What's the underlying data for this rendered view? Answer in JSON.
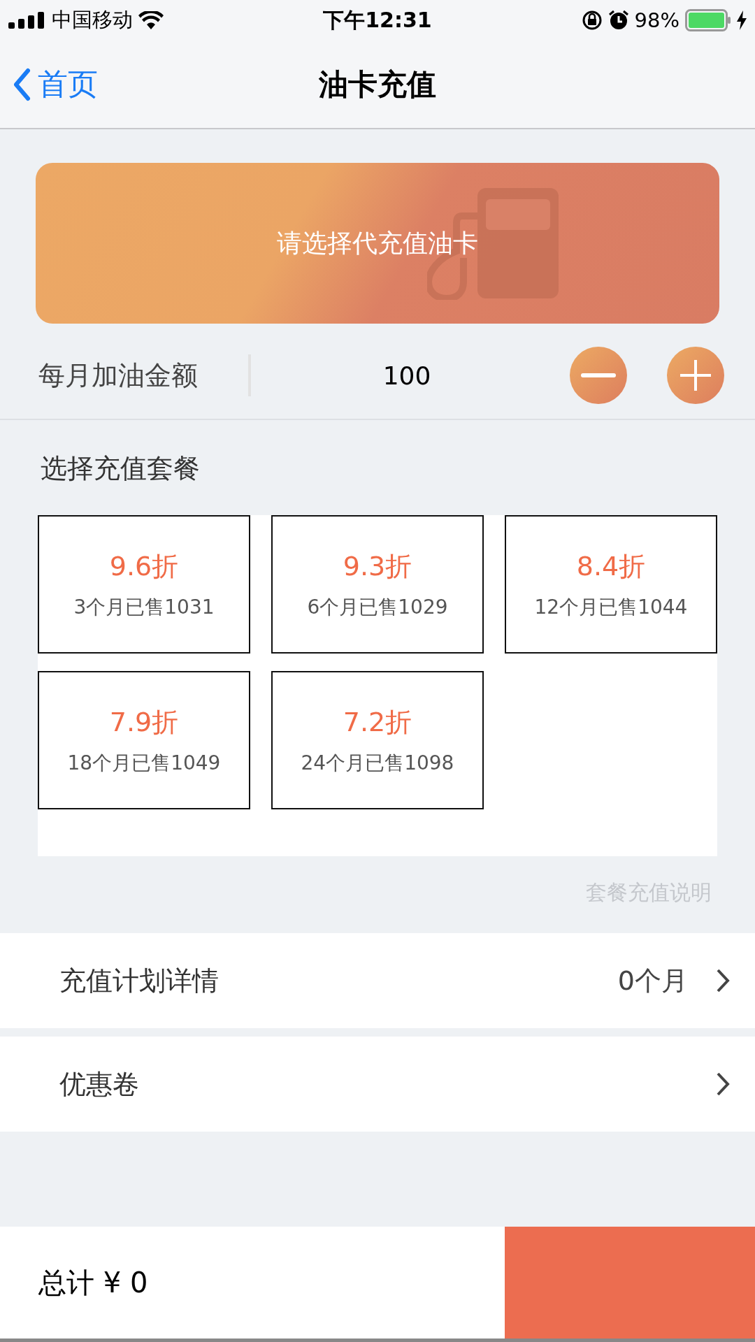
{
  "status_bar": {
    "carrier": "中国移动",
    "time": "下午12:31",
    "battery": "98%"
  },
  "nav": {
    "back": "首页",
    "title": "油卡充值"
  },
  "card_banner": {
    "label": "请选择代充值油卡"
  },
  "monthly_amount": {
    "label": "每月加油金额",
    "value": "100"
  },
  "packages": {
    "title": "选择充值套餐",
    "items": [
      {
        "discount": "9.6折",
        "detail": "3个月已售1031"
      },
      {
        "discount": "9.3折",
        "detail": "6个月已售1029"
      },
      {
        "discount": "8.4折",
        "detail": "12个月已售1044"
      },
      {
        "discount": "7.9折",
        "detail": "18个月已售1049"
      },
      {
        "discount": "7.2折",
        "detail": "24个月已售1098"
      }
    ],
    "note": "套餐充值说明"
  },
  "rows": [
    {
      "label": "充值计划详情",
      "value": "0个月"
    },
    {
      "label": "优惠卷"
    }
  ],
  "footer": {
    "total": "总计 ¥ 0"
  }
}
